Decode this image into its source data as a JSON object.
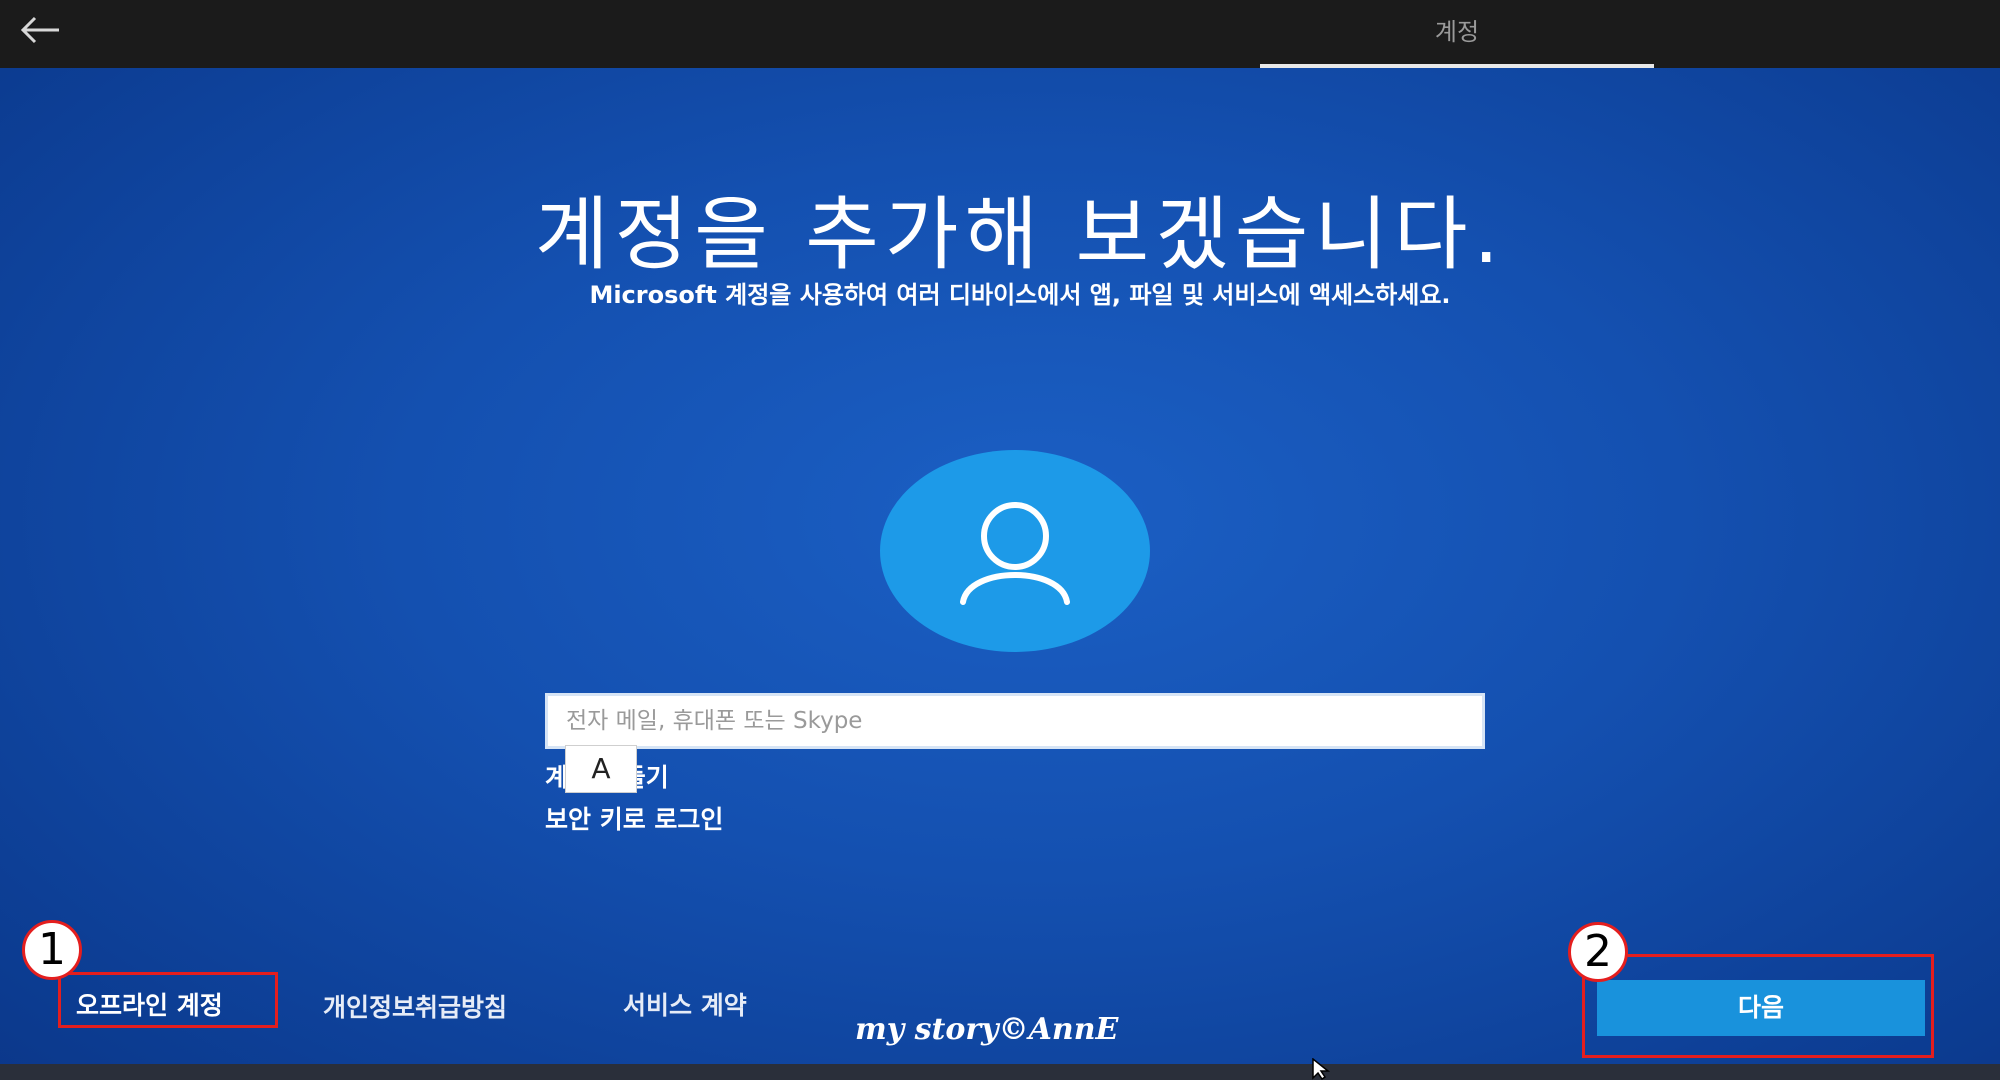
{
  "header": {
    "back_icon": "back-arrow-icon",
    "tab_label": "계정"
  },
  "main": {
    "title": "계정을 추가해 보겠습니다.",
    "subtitle": "Microsoft 계정을 사용하여 여러 디바이스에서 앱, 파일 및 서비스에 액세스하세요.",
    "avatar_icon": "user-icon",
    "email_input": {
      "placeholder": "전자 메일, 휴대폰 또는 Skype",
      "value": ""
    },
    "ime_indicator": "A",
    "links": {
      "create_account": "계정 만들기",
      "security_key_login": "보안 키로 로그인"
    }
  },
  "footer": {
    "offline_account": "오프라인 계정",
    "privacy": "개인정보취급방침",
    "service_agreement": "서비스 계약",
    "next_button": "다음"
  },
  "annotations": {
    "marker_1": "1",
    "marker_2": "2",
    "color": "#e41e1e"
  },
  "watermark": "my story©AnnE",
  "colors": {
    "panel_blue": "#1450b0",
    "avatar_blue": "#1d9ae8",
    "button_blue": "#1992dc"
  }
}
